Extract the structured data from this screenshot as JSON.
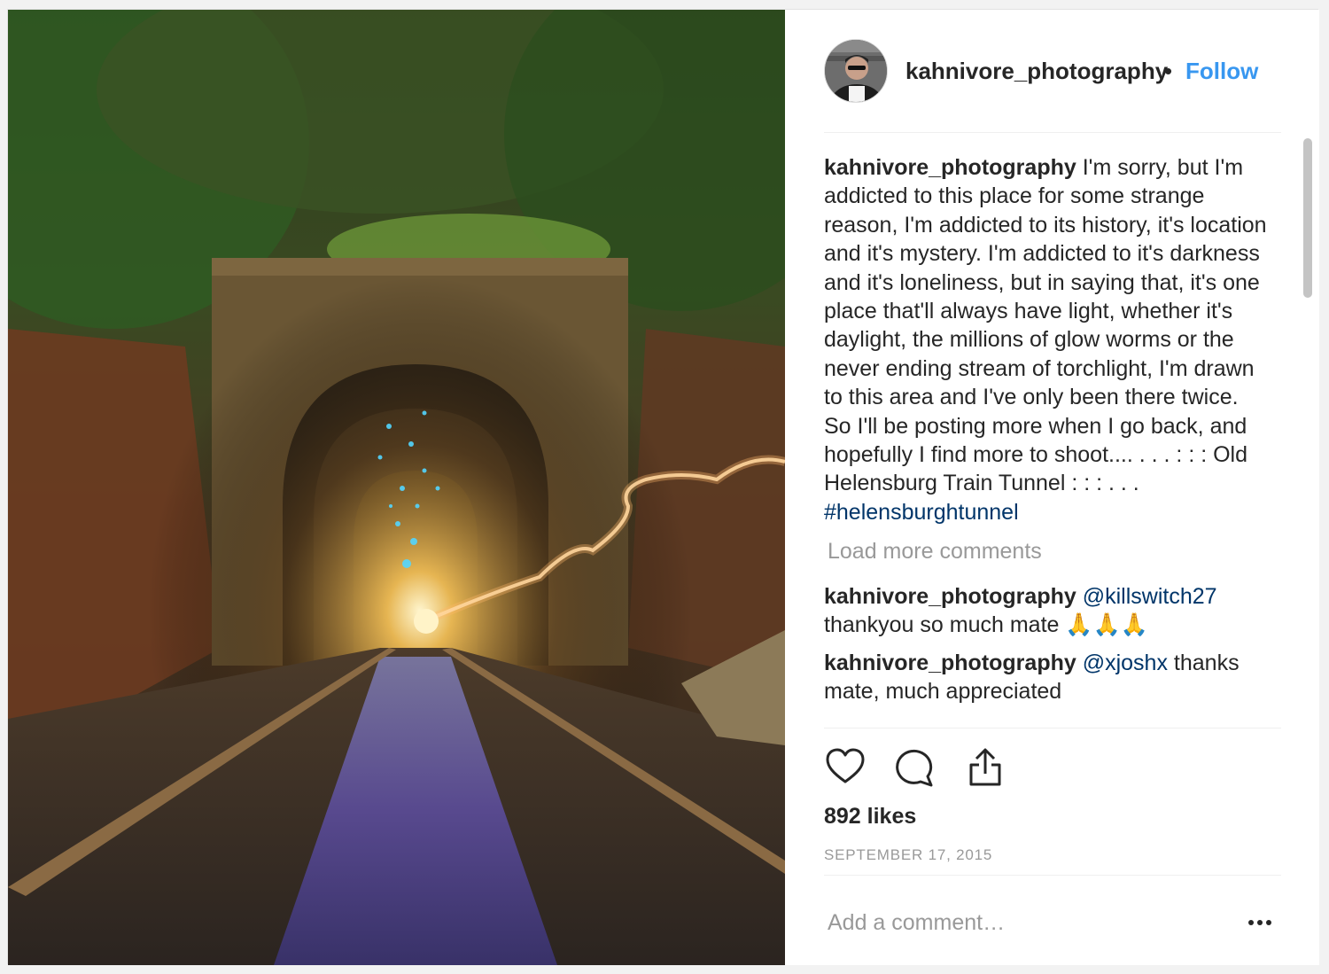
{
  "post": {
    "username": "kahnivore_photography",
    "separator": "•",
    "follow_label": "Follow",
    "caption": {
      "text": "I'm sorry, but I'm addicted to this place for some strange reason, I'm addicted to its history, it's location and it's mystery. I'm addicted to it's darkness and it's loneliness, but in saying that, it's one place that'll always have light, whether it's daylight, the millions of glow worms or the never ending stream of torchlight, I'm drawn to this area and I've only been there twice. So I'll be posting more when I go back, and hopefully I find more to shoot.... . . . : : : Old Helensburg Train Tunnel : : : . . .",
      "hashtag": "#helensburghtunnel"
    },
    "load_more_label": "Load more comments",
    "comments": [
      {
        "username": "kahnivore_photography",
        "mention": "@killswitch27",
        "text": "thankyou so much mate 🙏🙏🙏"
      },
      {
        "username": "kahnivore_photography",
        "mention": "@xjoshx",
        "text": "thanks mate, much appreciated"
      }
    ],
    "likes": "892 likes",
    "date": "SEPTEMBER 17, 2015",
    "add_comment_placeholder": "Add a comment…",
    "icons": [
      "heart-icon",
      "comment-icon",
      "share-icon",
      "more-options-icon"
    ]
  }
}
